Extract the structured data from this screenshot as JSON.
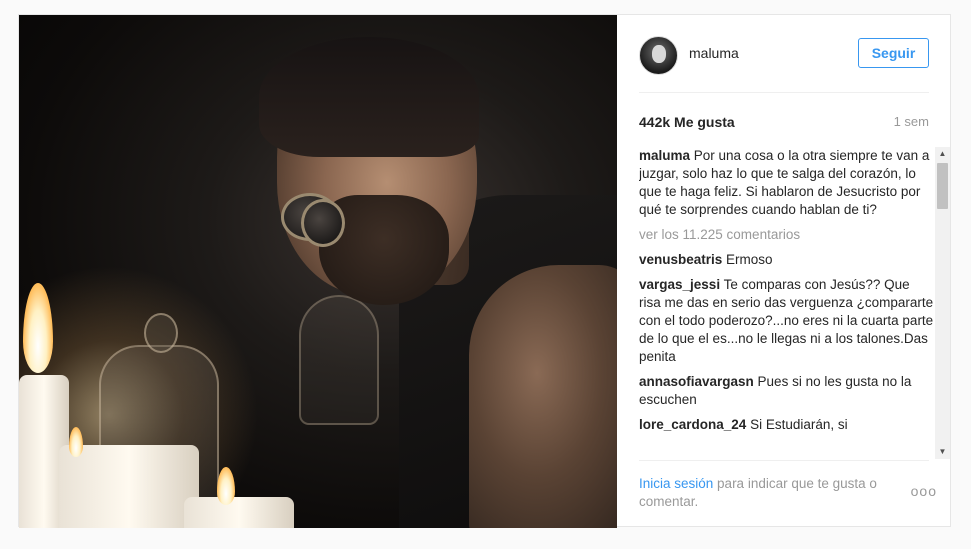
{
  "header": {
    "username": "maluma",
    "follow_label": "Seguir",
    "avatar_icon": "profile-avatar"
  },
  "stats": {
    "likes": "442k Me gusta",
    "time": "1 sem"
  },
  "caption": {
    "user": "maluma",
    "text": " Por una cosa o la otra siempre te van a juzgar, solo haz lo que te salga del corazón, lo que te haga feliz. Si hablaron de Jesucristo por qué te sorprendes cuando hablan de ti?"
  },
  "load_more": "ver los 11.225 comentarios",
  "comments": [
    {
      "user": "venusbeatris",
      "text": " Ermoso"
    },
    {
      "user": "vargas_jessi",
      "text": " Te comparas con Jesús?? Que risa me das en serio das verguenza ¿compararte con el todo poderozo?...no eres ni la cuarta parte de lo que el es...no le llegas ni a los talones.Das penita"
    },
    {
      "user": "annasofiavargasn",
      "text": " Pues si no les gusta no la escuchen "
    },
    {
      "user": "lore_cardona_24",
      "text": " Si Estudiarán, si"
    }
  ],
  "footer": {
    "login_link": "Inicia sesión",
    "rest": " para indicar que te gusta o comentar.",
    "more_label": "ooo"
  },
  "scrollbar": {
    "up_arrow": "▲",
    "down_arrow": "▼"
  },
  "colors": {
    "accent": "#3897f0",
    "muted": "#999999",
    "text": "#262626"
  }
}
